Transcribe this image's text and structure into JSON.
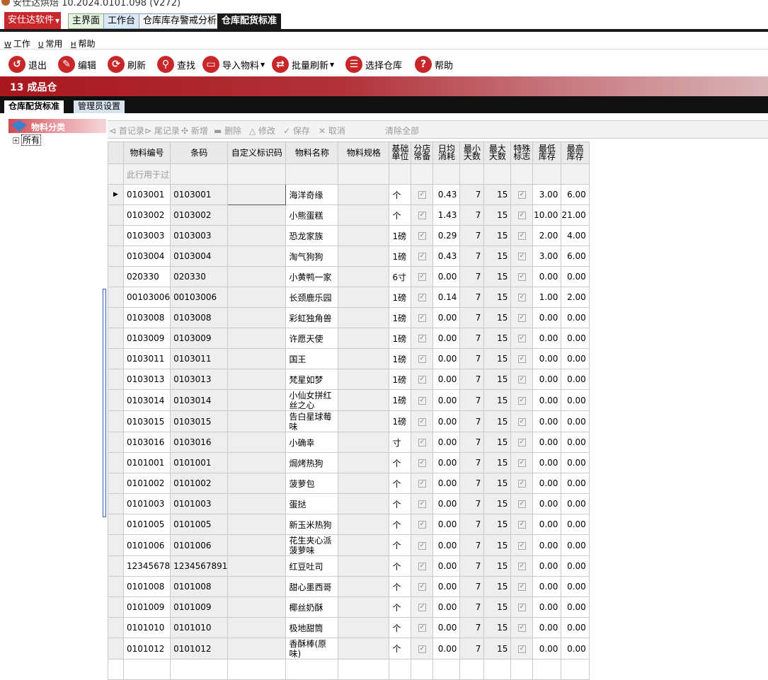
{
  "window": {
    "title": "安仕达烘焙    10.2024.0101.098 (V272)"
  },
  "tabbar": {
    "brand": "安仕达软件",
    "tabs": [
      "主界面",
      "工作台",
      "仓库库存警戒分析",
      "仓库配货标准"
    ]
  },
  "menubar": {
    "items": [
      {
        "key": "W",
        "label": "工作"
      },
      {
        "key": "U",
        "label": "常用"
      },
      {
        "key": "H",
        "label": "帮助"
      }
    ]
  },
  "toolbar": {
    "exit": "退出",
    "edit": "编辑",
    "refresh": "刷新",
    "find": "查找",
    "import": "导入物料",
    "batch_refresh": "批量刷新",
    "select_warehouse": "选择仓库",
    "help": "帮助"
  },
  "warehouse": {
    "title": "13  成品仓"
  },
  "subtabs": [
    "仓库配货标准",
    "管理员设置"
  ],
  "tree": {
    "root": "物料分类",
    "child": "所有"
  },
  "gridbar": {
    "first": "首记录",
    "last": "尾记录",
    "add": "新增",
    "delete": "删除",
    "modify": "修改",
    "save": "保存",
    "cancel": "取消",
    "clear_all": "清除全部"
  },
  "grid": {
    "headers": [
      "物料编号",
      "条码",
      "自定义标识码",
      "物料名称",
      "物料规格",
      "基础\n单位",
      "分店\n常备",
      "日均\n消耗",
      "最小\n天数",
      "最大\n天数",
      "特殊\n标志",
      "最低\n库存",
      "最高\n库存"
    ],
    "filter_placeholder": "此行用于过",
    "rows": [
      {
        "code": "0103001",
        "barcode": "0103001",
        "name": "海洋奇缘",
        "unit": "个",
        "daily": "0.43",
        "min_days": "7",
        "max_days": "15",
        "min_stock": "3.00",
        "max_stock": "6.00"
      },
      {
        "code": "0103002",
        "barcode": "0103002",
        "name": "小熊蛋糕",
        "unit": "个",
        "daily": "1.43",
        "min_days": "7",
        "max_days": "15",
        "min_stock": "10.00",
        "max_stock": "21.00"
      },
      {
        "code": "0103003",
        "barcode": "0103003",
        "name": "恐龙家族",
        "unit": "1磅",
        "daily": "0.29",
        "min_days": "7",
        "max_days": "15",
        "min_stock": "2.00",
        "max_stock": "4.00"
      },
      {
        "code": "0103004",
        "barcode": "0103004",
        "name": "淘气狗狗",
        "unit": "1磅",
        "daily": "0.43",
        "min_days": "7",
        "max_days": "15",
        "min_stock": "3.00",
        "max_stock": "6.00"
      },
      {
        "code": "020330",
        "barcode": "020330",
        "name": "小黄鸭一家",
        "unit": "6寸",
        "daily": "0.00",
        "min_days": "7",
        "max_days": "15",
        "min_stock": "0.00",
        "max_stock": "0.00"
      },
      {
        "code": "00103006",
        "barcode": "00103006",
        "name": "长颈鹿乐园",
        "unit": "1磅",
        "daily": "0.14",
        "min_days": "7",
        "max_days": "15",
        "min_stock": "1.00",
        "max_stock": "2.00"
      },
      {
        "code": "0103008",
        "barcode": "0103008",
        "name": "彩虹独角兽",
        "unit": "1磅",
        "daily": "0.00",
        "min_days": "7",
        "max_days": "15",
        "min_stock": "0.00",
        "max_stock": "0.00"
      },
      {
        "code": "0103009",
        "barcode": "0103009",
        "name": "许愿天使",
        "unit": "1磅",
        "daily": "0.00",
        "min_days": "7",
        "max_days": "15",
        "min_stock": "0.00",
        "max_stock": "0.00"
      },
      {
        "code": "0103011",
        "barcode": "0103011",
        "name": "国王",
        "unit": "1磅",
        "daily": "0.00",
        "min_days": "7",
        "max_days": "15",
        "min_stock": "0.00",
        "max_stock": "0.00"
      },
      {
        "code": "0103013",
        "barcode": "0103013",
        "name": "梵星如梦",
        "unit": "1磅",
        "daily": "0.00",
        "min_days": "7",
        "max_days": "15",
        "min_stock": "0.00",
        "max_stock": "0.00"
      },
      {
        "code": "0103014",
        "barcode": "0103014",
        "name": "小仙女拼红丝之心",
        "unit": "1磅",
        "daily": "0.00",
        "min_days": "7",
        "max_days": "15",
        "min_stock": "0.00",
        "max_stock": "0.00"
      },
      {
        "code": "0103015",
        "barcode": "0103015",
        "name": "告白星球莓味",
        "unit": "1磅",
        "daily": "0.00",
        "min_days": "7",
        "max_days": "15",
        "min_stock": "0.00",
        "max_stock": "0.00"
      },
      {
        "code": "0103016",
        "barcode": "0103016",
        "name": "小确幸",
        "unit": "寸",
        "daily": "0.00",
        "min_days": "7",
        "max_days": "15",
        "min_stock": "0.00",
        "max_stock": "0.00"
      },
      {
        "code": "0101001",
        "barcode": "0101001",
        "name": "焗烤热狗",
        "unit": "个",
        "daily": "0.00",
        "min_days": "7",
        "max_days": "15",
        "min_stock": "0.00",
        "max_stock": "0.00"
      },
      {
        "code": "0101002",
        "barcode": "0101002",
        "name": "菠萝包",
        "unit": "个",
        "daily": "0.00",
        "min_days": "7",
        "max_days": "15",
        "min_stock": "0.00",
        "max_stock": "0.00"
      },
      {
        "code": "0101003",
        "barcode": "0101003",
        "name": "蛋挞",
        "unit": "个",
        "daily": "0.00",
        "min_days": "7",
        "max_days": "15",
        "min_stock": "0.00",
        "max_stock": "0.00"
      },
      {
        "code": "0101005",
        "barcode": "0101005",
        "name": "新玉米热狗",
        "unit": "个",
        "daily": "0.00",
        "min_days": "7",
        "max_days": "15",
        "min_stock": "0.00",
        "max_stock": "0.00"
      },
      {
        "code": "0101006",
        "barcode": "0101006",
        "name": "花生夹心派菠萝味",
        "unit": "个",
        "daily": "0.00",
        "min_days": "7",
        "max_days": "15",
        "min_stock": "0.00",
        "max_stock": "0.00"
      },
      {
        "code": "12345678",
        "barcode": "1234567891",
        "name": "红豆吐司",
        "unit": "个",
        "daily": "0.00",
        "min_days": "7",
        "max_days": "15",
        "min_stock": "0.00",
        "max_stock": "0.00"
      },
      {
        "code": "0101008",
        "barcode": "0101008",
        "name": "甜心墨西哥",
        "unit": "个",
        "daily": "0.00",
        "min_days": "7",
        "max_days": "15",
        "min_stock": "0.00",
        "max_stock": "0.00"
      },
      {
        "code": "0101009",
        "barcode": "0101009",
        "name": "椰丝奶酥",
        "unit": "个",
        "daily": "0.00",
        "min_days": "7",
        "max_days": "15",
        "min_stock": "0.00",
        "max_stock": "0.00"
      },
      {
        "code": "0101010",
        "barcode": "0101010",
        "name": "极地甜筒",
        "unit": "个",
        "daily": "0.00",
        "min_days": "7",
        "max_days": "15",
        "min_stock": "0.00",
        "max_stock": "0.00"
      },
      {
        "code": "0101012",
        "barcode": "0101012",
        "name": "香酥棒(原味)",
        "unit": "个",
        "daily": "0.00",
        "min_days": "7",
        "max_days": "15",
        "min_stock": "0.00",
        "max_stock": "0.00"
      }
    ]
  },
  "colors": {
    "brand_red": "#c8282b",
    "header_dark": "#1a1a1a",
    "warehouse_bar": "#a8171d"
  }
}
